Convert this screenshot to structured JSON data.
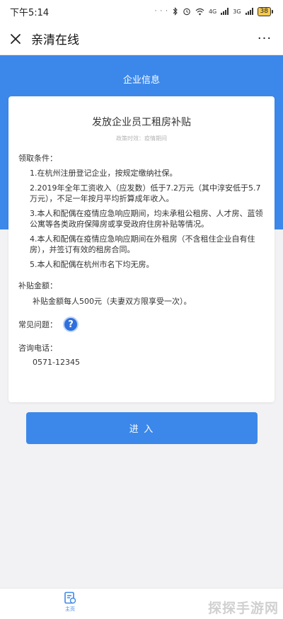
{
  "status_bar": {
    "time": "下午5:14",
    "dots": "· · ·",
    "net1": "4G",
    "net2": "3G",
    "battery": "38"
  },
  "nav": {
    "title": "亲清在线",
    "more": "···"
  },
  "header": {
    "section_title": "企业信息"
  },
  "card": {
    "title": "发放企业员工租房补贴",
    "subtitle": "政策时效：疫情期间",
    "conditions_label": "领取条件：",
    "conditions": [
      "1.在杭州注册登记企业，按规定缴纳社保。",
      "2.2019年全年工资收入（应发数）低于7.2万元（其中淳安低于5.7万元），不足一年按月平均折算成年收入。",
      "3.本人和配偶在疫情应急响应期间，均未承租公租房、人才房、蓝领公寓等各类政府保障房或享受政府住房补贴等情况。",
      "4.本人和配偶在疫情应急响应期间在外租房（不含租住企业自有住房），并签订有效的租房合同。",
      "5.本人和配偶在杭州市名下均无房。"
    ],
    "subsidy_label": "补贴金额：",
    "subsidy_text": "补贴金额每人500元（夫妻双方限享受一次）。",
    "faq_label": "常见问题：",
    "faq_icon": "?",
    "phone_label": "咨询电话：",
    "phone": "0571-12345"
  },
  "enter_button": "进 入",
  "bottom_tabs": [
    {
      "label": "主页",
      "icon": "home-doc-icon"
    }
  ],
  "watermark": "探探手游网",
  "colors": {
    "accent": "#3c88ea",
    "background": "#f2f2f4"
  }
}
